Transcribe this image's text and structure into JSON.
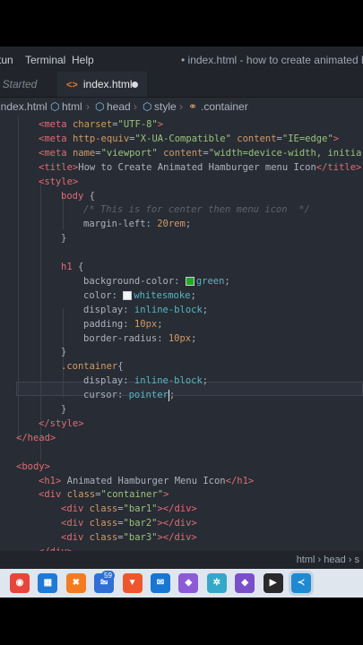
{
  "menubar": {
    "items": [
      "tun",
      "Terminal",
      "Help"
    ],
    "title": "• index.html - how to create animated hambur"
  },
  "tabs": [
    {
      "label": "t Started",
      "active": false
    },
    {
      "label": "index.html",
      "active": true,
      "icon": "html-file-icon",
      "modified": true
    }
  ],
  "breadcrumb": [
    "index.html",
    "html",
    "head",
    "style",
    ".container"
  ],
  "editor": {
    "lines": [
      {
        "indent": 1,
        "parts": [
          [
            "tag",
            "<meta "
          ],
          [
            "attr",
            "charset"
          ],
          [
            "txt",
            "="
          ],
          [
            "str",
            "\"UTF-8\""
          ],
          [
            "tag",
            ">"
          ]
        ]
      },
      {
        "indent": 1,
        "parts": [
          [
            "tag",
            "<meta "
          ],
          [
            "attr",
            "http-equiv"
          ],
          [
            "txt",
            "="
          ],
          [
            "str",
            "\"X-UA-Compatible\""
          ],
          [
            "txt",
            " "
          ],
          [
            "attr",
            "content"
          ],
          [
            "txt",
            "="
          ],
          [
            "str",
            "\"IE=edge\""
          ],
          [
            "tag",
            ">"
          ]
        ]
      },
      {
        "indent": 1,
        "parts": [
          [
            "tag",
            "<meta "
          ],
          [
            "attr",
            "name"
          ],
          [
            "txt",
            "="
          ],
          [
            "str",
            "\"viewport\""
          ],
          [
            "txt",
            " "
          ],
          [
            "attr",
            "content"
          ],
          [
            "txt",
            "="
          ],
          [
            "str",
            "\"width=device-width, initia"
          ]
        ]
      },
      {
        "indent": 1,
        "parts": [
          [
            "tag",
            "<title>"
          ],
          [
            "txt",
            "How to Create Animated Hamburger menu Icon"
          ],
          [
            "tag",
            "</title>"
          ]
        ]
      },
      {
        "indent": 1,
        "parts": [
          [
            "tag",
            "<style>"
          ]
        ]
      },
      {
        "indent": 2,
        "parts": [
          [
            "sel",
            "body"
          ],
          [
            "txt",
            " {"
          ]
        ]
      },
      {
        "indent": 3,
        "parts": [
          [
            "cmt",
            "/* This is for center then menu icon  */"
          ]
        ]
      },
      {
        "indent": 3,
        "parts": [
          [
            "prop",
            "margin-left"
          ],
          [
            "txt",
            ": "
          ],
          [
            "num",
            "20rem"
          ],
          [
            "txt",
            ";"
          ]
        ]
      },
      {
        "indent": 2,
        "parts": [
          [
            "txt",
            "}"
          ]
        ]
      },
      {
        "indent": 0,
        "parts": []
      },
      {
        "indent": 2,
        "parts": [
          [
            "sel",
            "h1"
          ],
          [
            "txt",
            " {"
          ]
        ]
      },
      {
        "indent": 3,
        "parts": [
          [
            "prop",
            "background-color"
          ],
          [
            "txt",
            ": "
          ],
          [
            "swatch",
            "#22aa22"
          ],
          [
            "val",
            "green"
          ],
          [
            "txt",
            ";"
          ]
        ]
      },
      {
        "indent": 3,
        "parts": [
          [
            "prop",
            "color"
          ],
          [
            "txt",
            ": "
          ],
          [
            "swatch",
            "#f5f5f5"
          ],
          [
            "val",
            "whitesmoke"
          ],
          [
            "txt",
            ";"
          ]
        ]
      },
      {
        "indent": 3,
        "parts": [
          [
            "prop",
            "display"
          ],
          [
            "txt",
            ": "
          ],
          [
            "val",
            "inline-block"
          ],
          [
            "txt",
            ";"
          ]
        ]
      },
      {
        "indent": 3,
        "parts": [
          [
            "prop",
            "padding"
          ],
          [
            "txt",
            ": "
          ],
          [
            "num",
            "10px"
          ],
          [
            "txt",
            ";"
          ]
        ]
      },
      {
        "indent": 3,
        "parts": [
          [
            "prop",
            "border-radius"
          ],
          [
            "txt",
            ": "
          ],
          [
            "num",
            "10px"
          ],
          [
            "txt",
            ";"
          ]
        ]
      },
      {
        "indent": 2,
        "parts": [
          [
            "txt",
            "}"
          ]
        ]
      },
      {
        "indent": 2,
        "parts": [
          [
            "selc",
            ".container"
          ],
          [
            "txt",
            "{"
          ]
        ]
      },
      {
        "indent": 3,
        "parts": [
          [
            "prop",
            "display"
          ],
          [
            "txt",
            ": "
          ],
          [
            "val",
            "inline-block"
          ],
          [
            "txt",
            ";"
          ]
        ]
      },
      {
        "indent": 3,
        "current": true,
        "parts": [
          [
            "prop",
            "cursor"
          ],
          [
            "txt",
            ": "
          ],
          [
            "val",
            "pointer"
          ],
          [
            "cursor",
            ""
          ],
          [
            "txt",
            ";"
          ]
        ]
      },
      {
        "indent": 2,
        "parts": [
          [
            "txt",
            "}"
          ]
        ]
      },
      {
        "indent": 1,
        "parts": [
          [
            "tag",
            "</style>"
          ]
        ]
      },
      {
        "indent": 0,
        "parts": [
          [
            "tag",
            "</head>"
          ]
        ]
      },
      {
        "indent": 0,
        "parts": []
      },
      {
        "indent": 0,
        "parts": [
          [
            "tag",
            "<body>"
          ]
        ]
      },
      {
        "indent": 1,
        "parts": [
          [
            "tag",
            "<h1>"
          ],
          [
            "txt",
            " Animated Hamburger Menu Icon"
          ],
          [
            "tag",
            "</h1>"
          ]
        ]
      },
      {
        "indent": 1,
        "parts": [
          [
            "tag",
            "<div "
          ],
          [
            "attr",
            "class"
          ],
          [
            "txt",
            "="
          ],
          [
            "str",
            "\"container\""
          ],
          [
            "tag",
            ">"
          ]
        ]
      },
      {
        "indent": 2,
        "parts": [
          [
            "tag",
            "<div "
          ],
          [
            "attr",
            "class"
          ],
          [
            "txt",
            "="
          ],
          [
            "str",
            "\"bar1\""
          ],
          [
            "tag",
            "></div>"
          ]
        ]
      },
      {
        "indent": 2,
        "parts": [
          [
            "tag",
            "<div "
          ],
          [
            "attr",
            "class"
          ],
          [
            "txt",
            "="
          ],
          [
            "str",
            "\"bar2\""
          ],
          [
            "tag",
            "></div>"
          ]
        ]
      },
      {
        "indent": 2,
        "parts": [
          [
            "tag",
            "<div "
          ],
          [
            "attr",
            "class"
          ],
          [
            "txt",
            "="
          ],
          [
            "str",
            "\"bar3\""
          ],
          [
            "tag",
            "></div>"
          ]
        ]
      },
      {
        "indent": 1,
        "parts": [
          [
            "tag",
            "</div>"
          ]
        ]
      }
    ]
  },
  "statusbar": {
    "text": "html › head › s"
  },
  "taskbar": [
    {
      "icon": "chrome-icon",
      "color": "#e8453c"
    },
    {
      "icon": "store-icon",
      "color": "#1f7ad6"
    },
    {
      "icon": "xampp-icon",
      "color": "#f47b20"
    },
    {
      "icon": "messaging-icon",
      "color": "#2f6fd6",
      "badge": "59"
    },
    {
      "icon": "brave-icon",
      "color": "#f0562e"
    },
    {
      "icon": "mail-icon",
      "color": "#1976d2"
    },
    {
      "icon": "visual-studio-icon",
      "color": "#8e5bd6"
    },
    {
      "icon": "tool-icon",
      "color": "#35a8c9"
    },
    {
      "icon": "visual-studio-icon",
      "color": "#7b4fc9"
    },
    {
      "icon": "media-icon",
      "color": "#2a2a2a"
    },
    {
      "icon": "vscode-icon",
      "color": "#1f8ad2",
      "active": true
    }
  ]
}
